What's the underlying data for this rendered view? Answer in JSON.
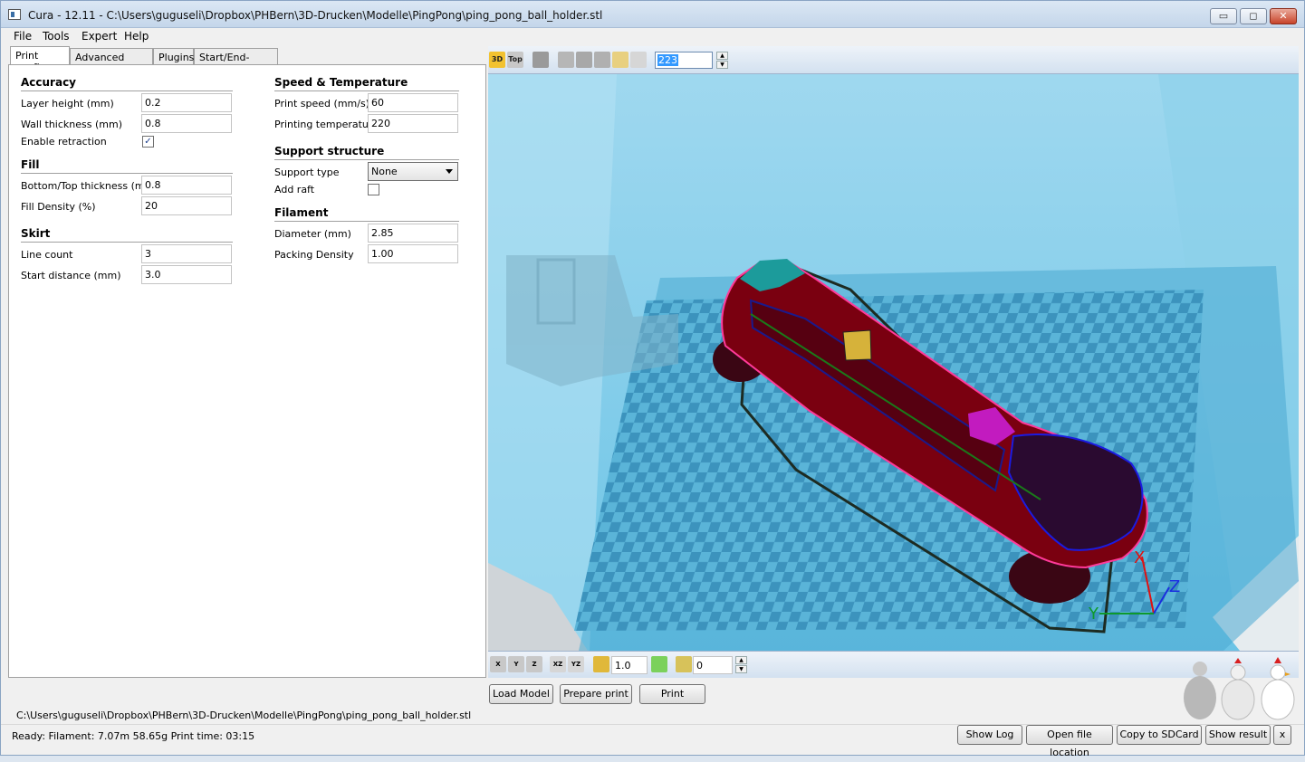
{
  "window": {
    "title": "Cura - 12.11 - C:\\Users\\guguseli\\Dropbox\\PHBern\\3D-Drucken\\Modelle\\PingPong\\ping_pong_ball_holder.stl",
    "minimize": "▭",
    "maximize": "◻",
    "close": "✕"
  },
  "menu": [
    "File",
    "Tools",
    "Expert",
    "Help"
  ],
  "tabs": [
    "Print config",
    "Advanced config",
    "Plugins",
    "Start/End-GCode"
  ],
  "left": {
    "accuracy": {
      "title": "Accuracy",
      "layer_height_label": "Layer height (mm)",
      "layer_height": "0.2",
      "wall_thickness_label": "Wall thickness (mm)",
      "wall_thickness": "0.8",
      "enable_retraction_label": "Enable retraction",
      "enable_retraction_check": "✓"
    },
    "fill": {
      "title": "Fill",
      "bottom_top_label": "Bottom/Top thickness (mm)",
      "bottom_top": "0.8",
      "density_label": "Fill Density (%)",
      "density": "20"
    },
    "skirt": {
      "title": "Skirt",
      "line_count_label": "Line count",
      "line_count": "3",
      "start_distance_label": "Start distance (mm)",
      "start_distance": "3.0"
    }
  },
  "right": {
    "speed": {
      "title": "Speed & Temperature",
      "print_speed_label": "Print speed (mm/s)",
      "print_speed": "60",
      "print_temp_label": "Printing temperature",
      "print_temp": "220"
    },
    "support": {
      "title": "Support structure",
      "type_label": "Support type",
      "type": "None",
      "raft_label": "Add raft"
    },
    "filament": {
      "title": "Filament",
      "diameter_label": "Diameter (mm)",
      "diameter": "2.85",
      "packing_label": "Packing Density",
      "packing": "1.00"
    }
  },
  "viewer": {
    "toolbar": {
      "btn_3d": "3D",
      "btn_top": "Top",
      "layer": "223"
    },
    "bottom": {
      "scale": "1.0",
      "rotate": "0"
    },
    "axis_x": "X",
    "axis_y": "Y",
    "axis_z": "Z"
  },
  "buttons": {
    "load": "Load Model",
    "prepare": "Prepare print",
    "print": "Print"
  },
  "file_path": "C:\\Users\\guguseli\\Dropbox\\PHBern\\3D-Drucken\\Modelle\\PingPong\\ping_pong_ball_holder.stl",
  "status": {
    "text": "Ready: Filament: 7.07m 58.65g Print time: 03:15",
    "show_log": "Show Log",
    "open_location": "Open file location",
    "copy_sd": "Copy to SDCard",
    "show_result": "Show result",
    "close": "x"
  },
  "colors": {
    "bed_blue": "#54bde0",
    "model_red": "#7a0010",
    "accent": "#3399ff"
  }
}
